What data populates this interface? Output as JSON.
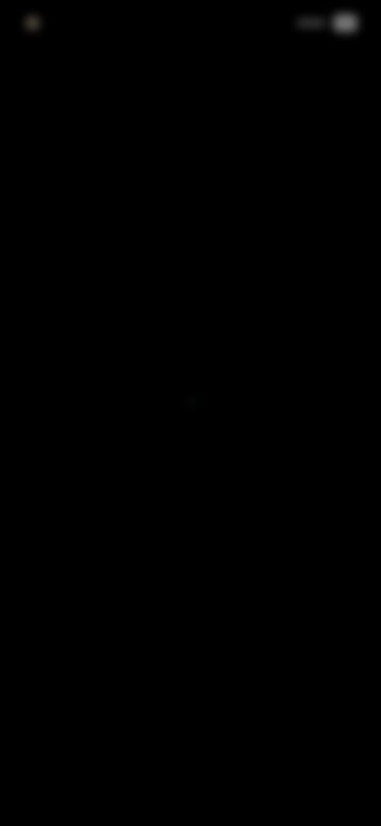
{
  "status_bar": {
    "time": "",
    "left_icon": "notification-dot-icon",
    "signal_icon": "signal-icon",
    "battery_icon": "battery-icon"
  },
  "center": {
    "message": "",
    "link_prefix": "",
    "link_action": "",
    "link_suffix": ""
  },
  "colors": {
    "background": "#000000",
    "accent": "#1f6e3c",
    "muted_text": "#6e6e6e",
    "link_text": "#b4b4b4"
  }
}
